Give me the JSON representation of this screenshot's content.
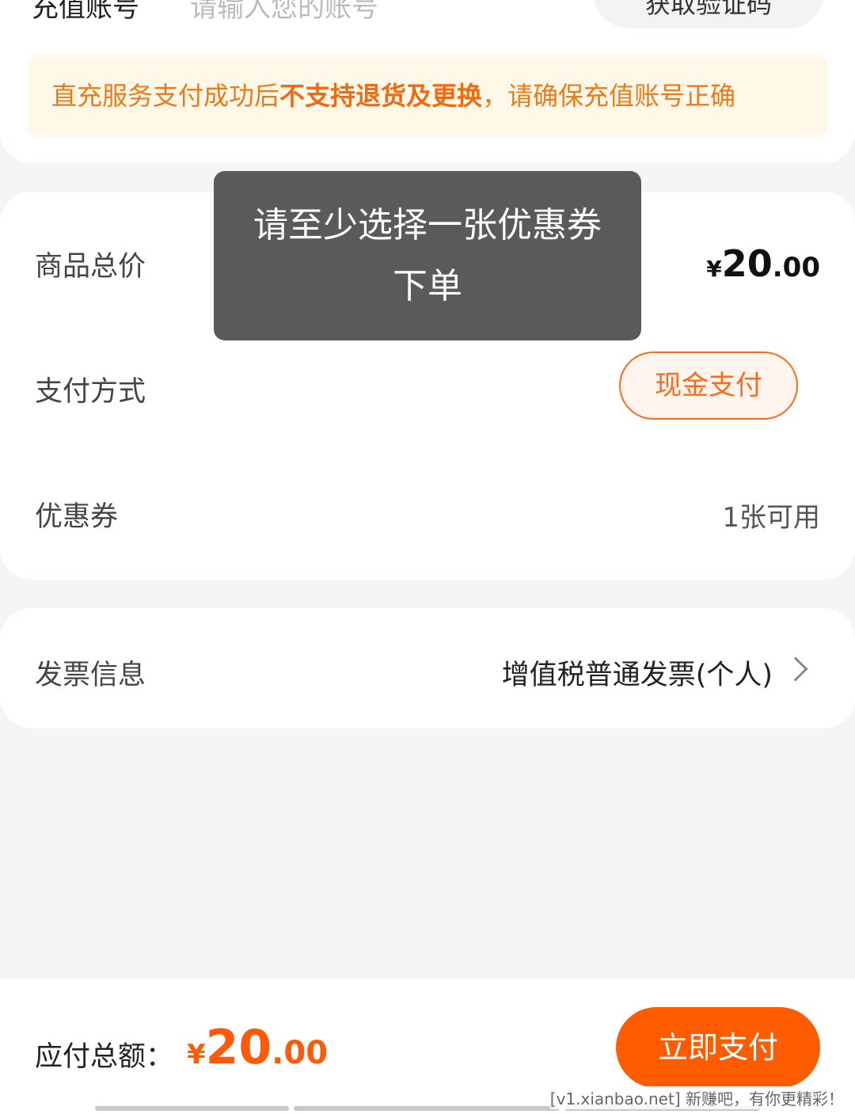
{
  "top": {
    "account_label": "充值账号",
    "account_placeholder": "请输入您的账号",
    "action_button": "获取验证码"
  },
  "notice": {
    "part1": "直充服务支付成功后",
    "part2": "不支持退货及更换",
    "part3": "，请确保充值账号正确"
  },
  "summary": {
    "total_label": "商品总价",
    "total_yen": "¥",
    "total_int": "20",
    "total_dec": ".00",
    "payment_label": "支付方式",
    "payment_value": "现金支付",
    "coupon_label": "优惠券",
    "coupon_value": "1张可用"
  },
  "invoice": {
    "label": "发票信息",
    "value": "增值税普通发票(个人)"
  },
  "toast": {
    "message": "请至少选择一张优惠券下单"
  },
  "bottom": {
    "total_label": "应付总额：",
    "yen": "¥",
    "int": "20",
    "dec": ".00",
    "pay_button": "立即支付"
  },
  "watermark": "[v1.xianbao.net] 新赚吧，有你更精彩！",
  "colors": {
    "accent": "#ff5c00",
    "notice_bg": "#fff8e8",
    "notice_text": "#ee7a17",
    "toast_bg": "#5a5a5a"
  }
}
